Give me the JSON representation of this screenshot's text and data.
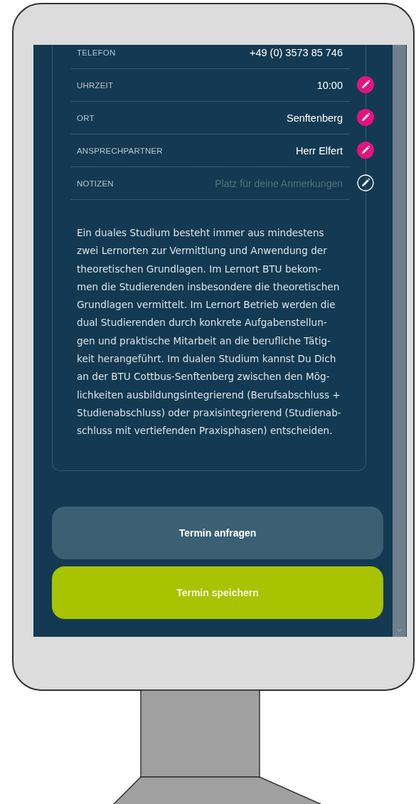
{
  "details": [
    {
      "label": "TELEFON",
      "value": "+49 (0) 3573 85 746",
      "editable": false
    },
    {
      "label": "UHRZEIT",
      "value": "10:00",
      "editable": true,
      "filled": true
    },
    {
      "label": "ORT",
      "value": "Senftenberg",
      "editable": true,
      "filled": true
    },
    {
      "label": "ANSPRECHPARTNER",
      "value": "Herr Elfert",
      "editable": true,
      "filled": true
    },
    {
      "label": "NOTIZEN",
      "placeholder": "Platz für deine Anmerkungen",
      "editable": true,
      "filled": false
    }
  ],
  "description_lines": [
    "Ein duales Studium besteht immer aus mindestens",
    "zwei Lernorten zur Vermittlung und Anwendung der",
    "theoretischen Grundlagen. Im Lernort BTU bekom-",
    "men die Studierenden insbesondere die theoretischen",
    "Grundlagen vermittelt. Im Lernort Betrieb werden die",
    "dual Studierenden durch konkrete Aufgabenstellun-",
    "gen und praktische Mitarbeit an die berufliche Tätig-",
    "keit herangeführt. Im dualen Studium kannst Du Dich",
    "an der BTU Cottbus-Senftenberg zwischen den Mög-",
    "lichkeiten ausbildungsintegrierend (Berufsabschluss +",
    "Studienabschluss) oder praxisintegrierend (Studienab-",
    "schluss mit vertiefenden Praxisphasen) entscheiden."
  ],
  "buttons": [
    {
      "label": "Termin anfragen",
      "kind": "secondary"
    },
    {
      "label": "Termin speichern",
      "kind": "primary"
    }
  ]
}
